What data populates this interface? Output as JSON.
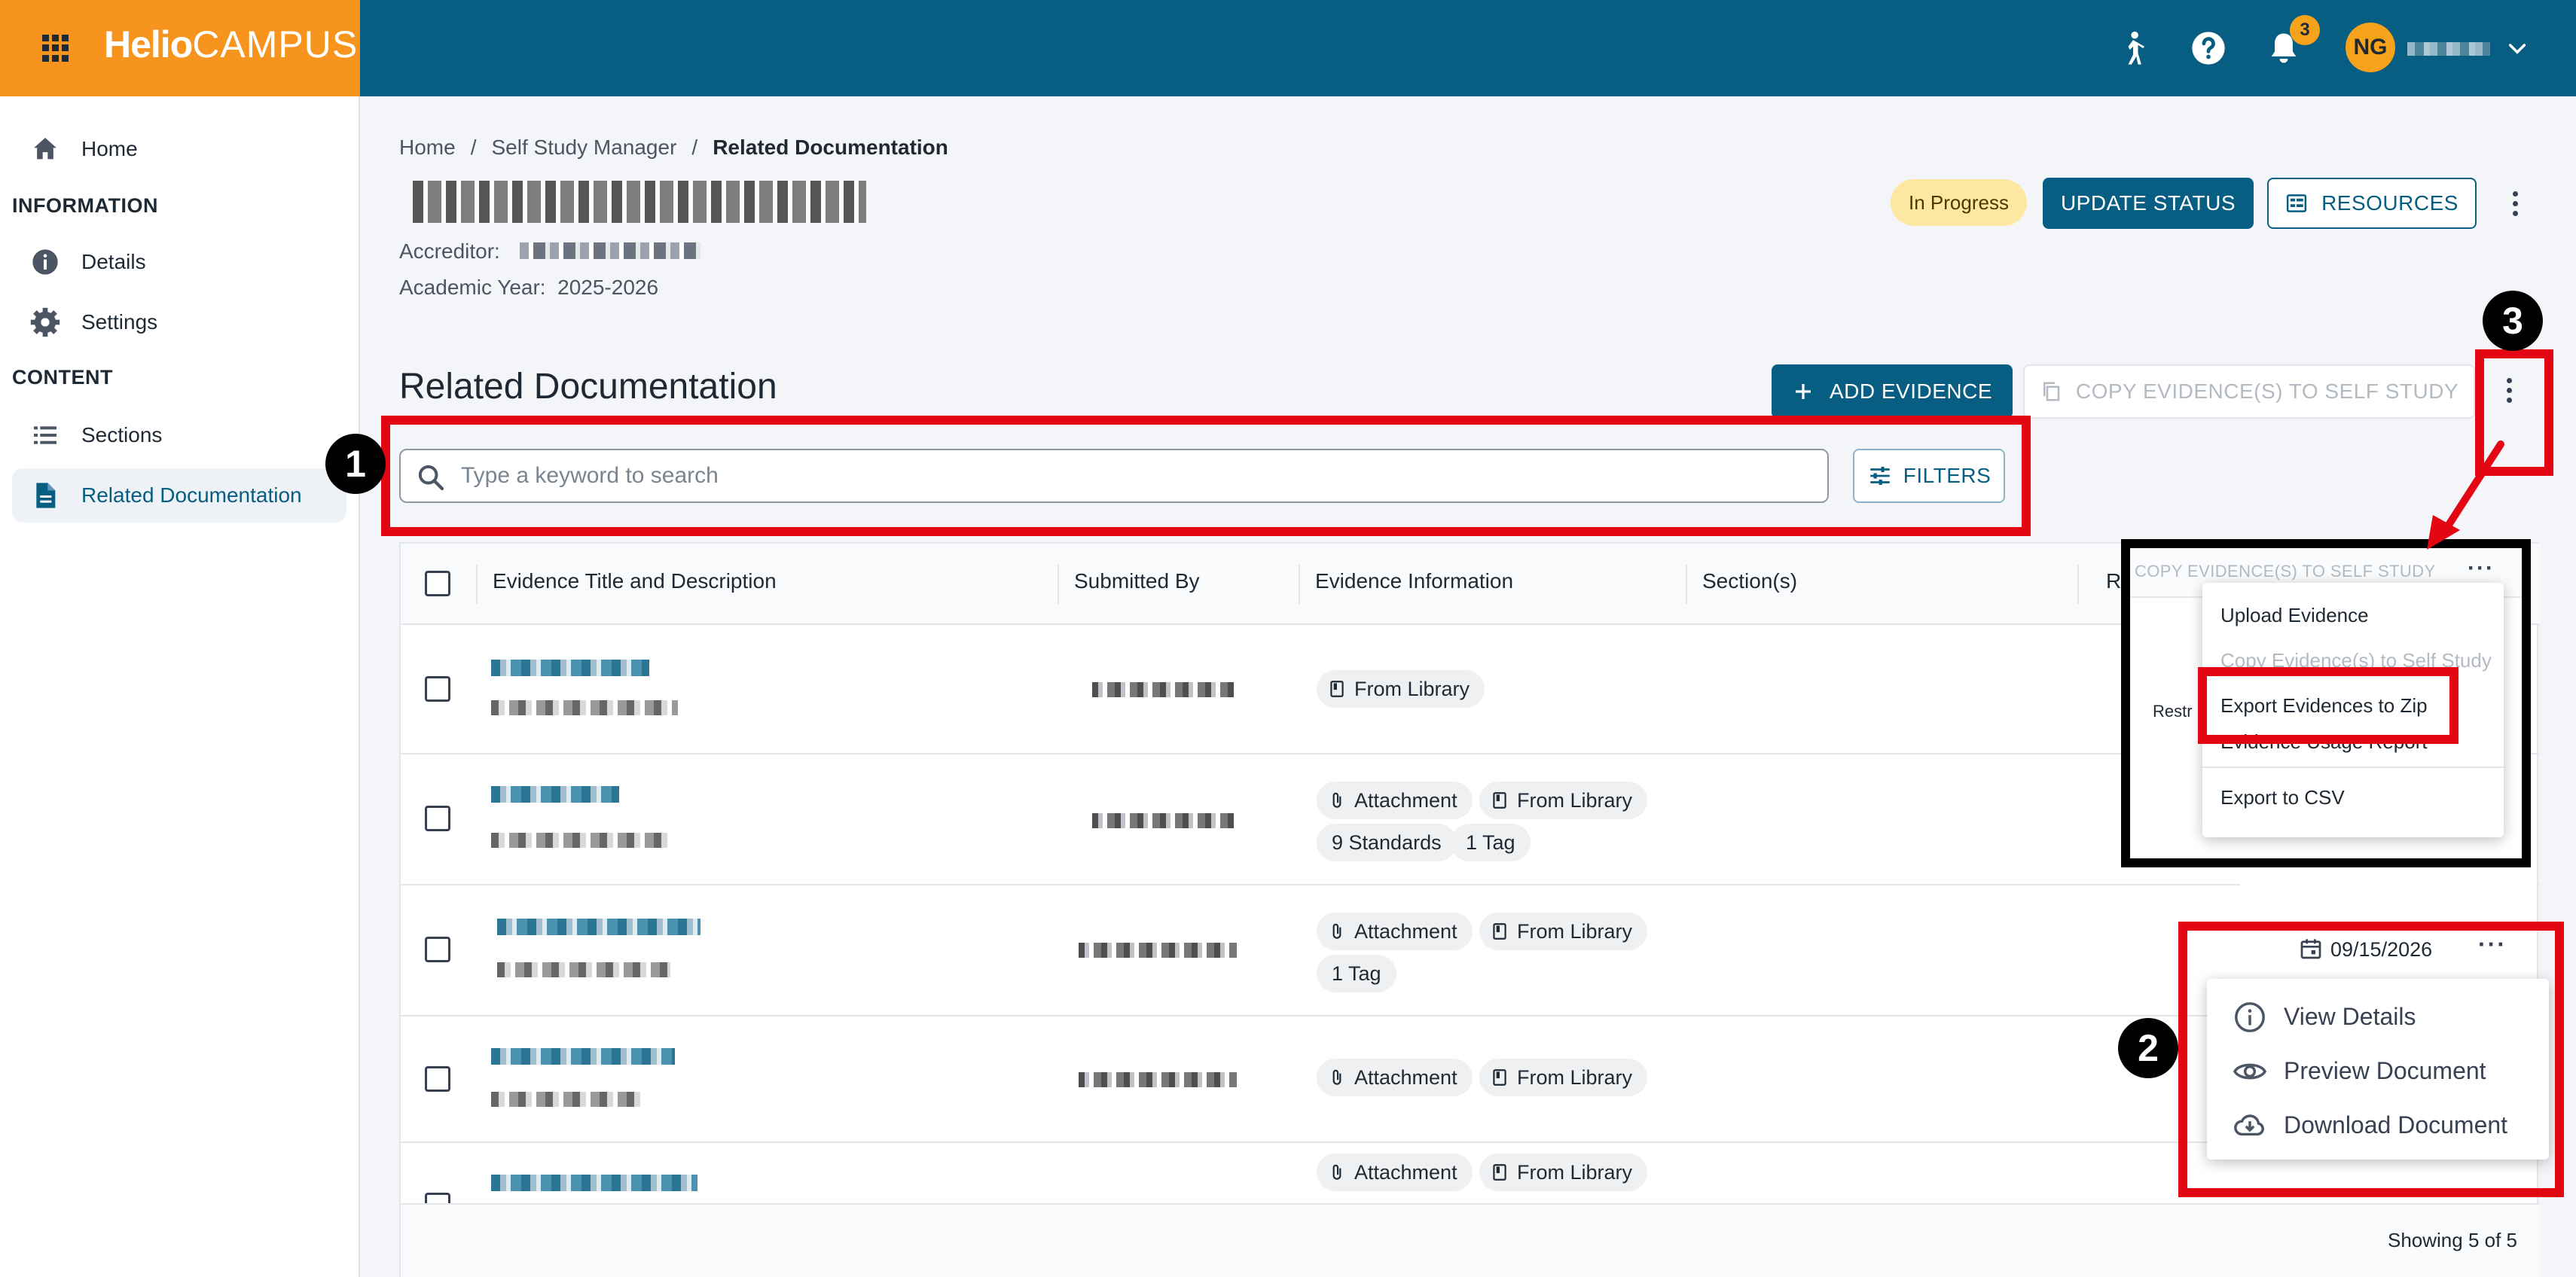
{
  "app": {
    "brand_bold": "Helio",
    "brand_light": "CAMPUS",
    "notification_count": "3",
    "user_initials": "NG"
  },
  "sidebar": {
    "home": "Home",
    "section_information": "INFORMATION",
    "details": "Details",
    "settings": "Settings",
    "section_content": "CONTENT",
    "sections": "Sections",
    "related_documentation": "Related Documentation"
  },
  "breadcrumb": {
    "home": "Home",
    "sep": "/",
    "self_study_manager": "Self Study Manager",
    "current": "Related Documentation"
  },
  "study": {
    "accreditor_label": "Accreditor:",
    "academic_year_label": "Academic Year:",
    "academic_year": "2025-2026",
    "status": "In Progress",
    "update_status": "UPDATE STATUS",
    "resources": "RESOURCES"
  },
  "page": {
    "title": "Related Documentation",
    "add_evidence": "ADD EVIDENCE",
    "copy_evidence": "COPY EVIDENCE(S) TO SELF STUDY",
    "filters": "FILTERS",
    "search_placeholder": "Type a keyword to search"
  },
  "table": {
    "columns": [
      "Evidence Title and Description",
      "Submitted By",
      "Evidence Information",
      "Section(s)",
      "R"
    ],
    "chip_library": "From Library",
    "chip_attachment": "Attachment",
    "chip_standards": "9 Standards",
    "chip_tag": "1 Tag",
    "row3_date": "09/15/2026",
    "showing": "Showing 5 of 5"
  },
  "zoom_panel": {
    "header_copy": "COPY EVIDENCE(S) TO SELF STUDY",
    "restr": "Restr",
    "menu": [
      "Upload Evidence",
      "Copy Evidence(s) to Self Study",
      "Export Evidences to Zip",
      "Evidence Usage Report",
      "Export to CSV"
    ]
  },
  "row_menu": [
    "View Details",
    "Preview Document",
    "Download Document"
  ],
  "callouts": [
    "1",
    "2",
    "3"
  ],
  "colors": {
    "primary": "#075e82",
    "brand": "#f7941d",
    "annotation": "#e30613"
  }
}
